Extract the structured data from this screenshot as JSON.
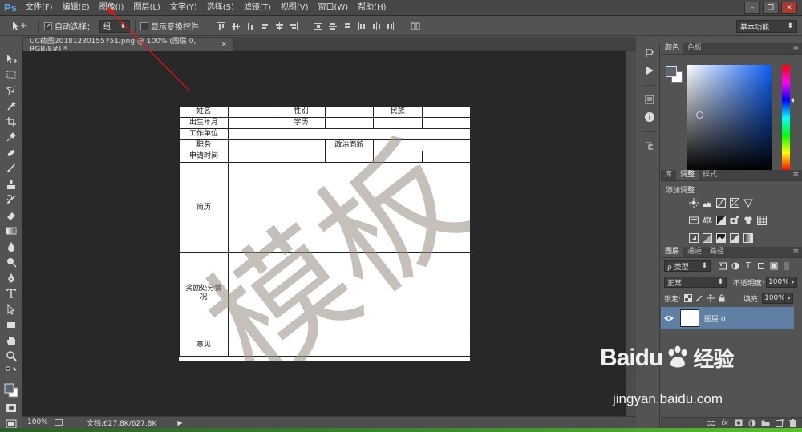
{
  "app": {
    "logo": "Ps"
  },
  "menu": [
    "文件(F)",
    "编辑(E)",
    "图像(I)",
    "图层(L)",
    "文字(Y)",
    "选择(S)",
    "滤镜(T)",
    "视图(V)",
    "窗口(W)",
    "帮助(H)"
  ],
  "window_controls": {
    "minimize": "–",
    "restore": "❐",
    "close": "✕"
  },
  "options": {
    "auto_select_label": "自动选择：",
    "auto_select_checked": true,
    "auto_select_value": "组",
    "transform_label": "显示变换控件",
    "transform_checked": false,
    "workspace": "基本功能"
  },
  "document": {
    "tab_title": "UC截图20181230155751.png @ 100% (图层 0, RGB/8#) *",
    "tab_close": "×",
    "zoom": "100%",
    "doc_info": "文档:627.8K/627.8K"
  },
  "form": {
    "r1": [
      "姓名",
      "性别",
      "民族"
    ],
    "r2": [
      "出生年月",
      "学历"
    ],
    "r3": [
      "工作单位"
    ],
    "r4": [
      "职务",
      "政治面貌"
    ],
    "r5": [
      "申请时间"
    ],
    "r6": [
      "简历"
    ],
    "r7": [
      "奖励处分情况"
    ],
    "r8": [
      "意见"
    ],
    "watermark_text": "模板"
  },
  "color_panel": {
    "tabs": [
      "颜色",
      "色板"
    ],
    "foreground": "#5a6475",
    "background": "#ffffff"
  },
  "adjust_panel": {
    "tabs": [
      "库",
      "调整",
      "样式"
    ],
    "title": "添加调整"
  },
  "layers_panel": {
    "tabs": [
      "图层",
      "通道",
      "路径"
    ],
    "filter_kind": "ρ 类型",
    "blend_mode": "正常",
    "opacity_label": "不透明度:",
    "opacity": "100%",
    "lock_label": "锁定:",
    "fill_label": "填充:",
    "fill": "100%",
    "layers": [
      {
        "name": "图层 0",
        "visible": true
      }
    ]
  },
  "overlay": {
    "brand": "Baidu",
    "brand_cn": "经验",
    "url": "jingyan.baidu.com"
  }
}
